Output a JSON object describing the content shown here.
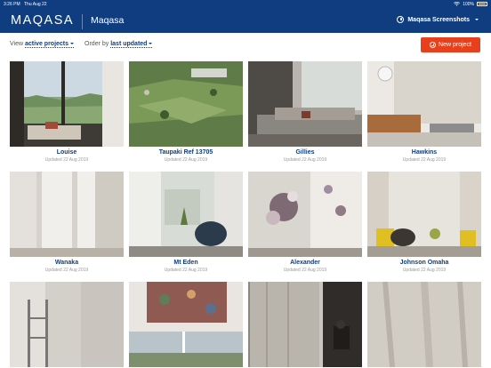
{
  "status_bar": {
    "time": "3:26 PM",
    "date": "Thu Aug 22",
    "battery": "100%"
  },
  "header": {
    "logo": "MAQASA",
    "title": "Maqasa",
    "account": "Maqasa Screenshots",
    "colors": {
      "primary": "#0f3d80",
      "accent": "#e8401c"
    }
  },
  "toolbar": {
    "view_label": "View",
    "view_value": "active projects",
    "order_label": "Order by",
    "order_value": "last updated",
    "new_project": "New project"
  },
  "projects": [
    {
      "name": "Louise",
      "updated": "Updated 22 Aug 2019"
    },
    {
      "name": "Taupaki Ref 13705",
      "updated": "Updated 22 Aug 2019"
    },
    {
      "name": "Gillies",
      "updated": "Updated 22 Aug 2019"
    },
    {
      "name": "Hawkins",
      "updated": "Updated 22 Aug 2019"
    },
    {
      "name": "Wanaka",
      "updated": "Updated 22 Aug 2019"
    },
    {
      "name": "Mt Eden",
      "updated": "Updated 22 Aug 2019"
    },
    {
      "name": "Alexander",
      "updated": "Updated 22 Aug 2019"
    },
    {
      "name": "Johnson Omaha",
      "updated": "Updated 22 Aug 2019"
    },
    {
      "name": "",
      "updated": ""
    },
    {
      "name": "",
      "updated": ""
    },
    {
      "name": "",
      "updated": ""
    },
    {
      "name": "",
      "updated": ""
    }
  ]
}
